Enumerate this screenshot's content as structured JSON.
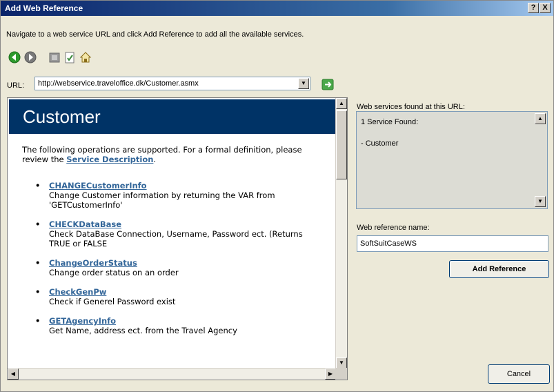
{
  "window": {
    "title": "Add Web Reference",
    "help_label": "?",
    "close_label": "X"
  },
  "instructions": "Navigate to a web service URL and click Add Reference to add all the available services.",
  "toolbar": {
    "icons": [
      "back-icon",
      "forward-icon",
      "stop-icon",
      "refresh-icon",
      "home-icon"
    ],
    "colors": {
      "back": "#2d9a2d",
      "forward": "#6a6a6a"
    }
  },
  "url": {
    "label": "URL:",
    "value": "http://webservice.traveloffice.dk/Customer.asmx"
  },
  "page": {
    "heading": "Customer",
    "intro_text": "The following operations are supported. For a formal definition, please review the ",
    "intro_link": "Service Description",
    "intro_end": ".",
    "header_color": "#003366",
    "operations": [
      {
        "name": "CHANGECustomerInfo",
        "desc": "Change Customer information by returning the VAR from 'GETCustomerInfo'"
      },
      {
        "name": "CHECKDataBase",
        "desc": "Check DataBase Connection, Username, Password ect. (Returns TRUE or FALSE"
      },
      {
        "name": "ChangeOrderStatus",
        "desc": "Change order status on an order"
      },
      {
        "name": "CheckGenPw",
        "desc": "Check if Generel Password exist"
      },
      {
        "name": "GETAgencyInfo",
        "desc": "Get Name, address ect. from the Travel Agency"
      }
    ]
  },
  "found": {
    "label": "Web services found at this URL:",
    "count_text": "1 Service Found:",
    "service": "- Customer"
  },
  "reference": {
    "label": "Web reference name:",
    "value": "SoftSuitCaseWS"
  },
  "buttons": {
    "add_reference": "Add Reference",
    "cancel": "Cancel"
  }
}
